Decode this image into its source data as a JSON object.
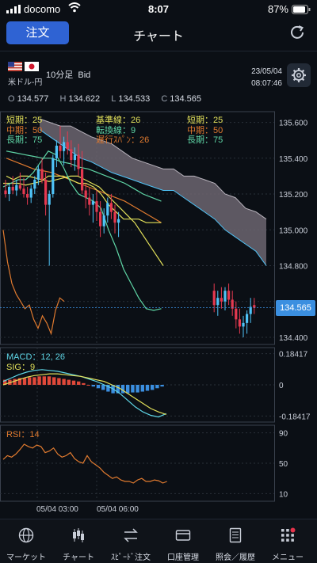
{
  "status_bar": {
    "carrier": "docomo",
    "time": "8:07",
    "battery": "87%"
  },
  "header": {
    "order_label": "注文",
    "title": "チャート"
  },
  "info": {
    "pair": "米ドル-円",
    "timeframe": "10分足",
    "side": "Bid",
    "date": "23/05/04",
    "time": "08:07:46"
  },
  "ohlc": [
    {
      "key": "O",
      "value": "134.577"
    },
    {
      "key": "H",
      "value": "134.622"
    },
    {
      "key": "L",
      "value": "134.533"
    },
    {
      "key": "C",
      "value": "134.565"
    }
  ],
  "main_legend": {
    "col1": [
      {
        "text": "短期：25",
        "color": "#e2e05a"
      },
      {
        "text": "中期：50",
        "color": "#e07a2f"
      },
      {
        "text": "長期：75",
        "color": "#5fd6a6"
      }
    ],
    "col2": [
      {
        "text": "基準線：26",
        "color": "#e2e05a"
      },
      {
        "text": "転換線：9",
        "color": "#5fd6a6"
      },
      {
        "text": "遅行ｽﾊﾟﾝ：26",
        "color": "#e07a2f"
      }
    ],
    "col3": [
      {
        "text": "短期：25",
        "color": "#e2e05a"
      },
      {
        "text": "中期：50",
        "color": "#e07a2f"
      },
      {
        "text": "長期：75",
        "color": "#5fd6a6"
      }
    ]
  },
  "current_price": "134.565",
  "macd": {
    "label": "MACD：12, 26",
    "sig": "SIG：9"
  },
  "rsi": {
    "label": "RSI：14"
  },
  "colors": {
    "up": "#4fc3f7",
    "down": "#e53950",
    "accent": "#2f63d3"
  },
  "chart_data": [
    {
      "type": "candlestick",
      "title": "",
      "ylim": [
        134.36,
        135.66
      ],
      "yticks": [
        135.6,
        135.4,
        135.2,
        135.0,
        134.8,
        134.6,
        134.4
      ],
      "ytick_labels": [
        "135.600",
        "135.400",
        "135.200",
        "135.000",
        "134.800",
        "134.565",
        "134.400"
      ],
      "x_labels": [
        "05/04 03:00",
        "05/04 06:00"
      ],
      "candles": [
        {
          "o": 135.22,
          "h": 135.28,
          "l": 135.18,
          "c": 135.2
        },
        {
          "o": 135.2,
          "h": 135.26,
          "l": 135.16,
          "c": 135.24
        },
        {
          "o": 135.24,
          "h": 135.3,
          "l": 135.2,
          "c": 135.22
        },
        {
          "o": 135.22,
          "h": 135.28,
          "l": 135.19,
          "c": 135.25
        },
        {
          "o": 135.25,
          "h": 135.32,
          "l": 135.22,
          "c": 135.23
        },
        {
          "o": 135.23,
          "h": 135.29,
          "l": 135.18,
          "c": 135.2
        },
        {
          "o": 135.2,
          "h": 135.24,
          "l": 135.14,
          "c": 135.18
        },
        {
          "o": 135.18,
          "h": 135.25,
          "l": 135.15,
          "c": 135.23
        },
        {
          "o": 135.23,
          "h": 135.3,
          "l": 135.2,
          "c": 135.28
        },
        {
          "o": 135.28,
          "h": 135.36,
          "l": 135.25,
          "c": 135.34
        },
        {
          "o": 135.34,
          "h": 135.4,
          "l": 135.26,
          "c": 135.28
        },
        {
          "o": 135.28,
          "h": 135.32,
          "l": 135.08,
          "c": 135.14
        },
        {
          "o": 135.14,
          "h": 135.22,
          "l": 134.8,
          "c": 135.2
        },
        {
          "o": 135.2,
          "h": 135.42,
          "l": 135.18,
          "c": 135.4
        },
        {
          "o": 135.4,
          "h": 135.5,
          "l": 135.35,
          "c": 135.47
        },
        {
          "o": 135.47,
          "h": 135.58,
          "l": 135.4,
          "c": 135.44
        },
        {
          "o": 135.44,
          "h": 135.52,
          "l": 135.36,
          "c": 135.49
        },
        {
          "o": 135.49,
          "h": 135.55,
          "l": 135.42,
          "c": 135.45
        },
        {
          "o": 135.45,
          "h": 135.5,
          "l": 135.35,
          "c": 135.39
        },
        {
          "o": 135.39,
          "h": 135.46,
          "l": 135.33,
          "c": 135.42
        },
        {
          "o": 135.42,
          "h": 135.48,
          "l": 135.3,
          "c": 135.34
        },
        {
          "o": 135.34,
          "h": 135.44,
          "l": 135.2,
          "c": 135.22
        },
        {
          "o": 135.22,
          "h": 135.26,
          "l": 135.12,
          "c": 135.18
        },
        {
          "o": 135.18,
          "h": 135.24,
          "l": 135.08,
          "c": 135.14
        },
        {
          "o": 135.14,
          "h": 135.2,
          "l": 135.04,
          "c": 135.16
        },
        {
          "o": 135.16,
          "h": 135.22,
          "l": 135.05,
          "c": 135.1
        },
        {
          "o": 135.1,
          "h": 135.16,
          "l": 134.96,
          "c": 135.02
        },
        {
          "o": 135.02,
          "h": 135.12,
          "l": 134.98,
          "c": 135.08
        },
        {
          "o": 135.08,
          "h": 135.18,
          "l": 135.04,
          "c": 135.15
        },
        {
          "o": 135.15,
          "h": 135.2,
          "l": 135.06,
          "c": 135.1
        },
        {
          "o": 135.1,
          "h": 135.14,
          "l": 134.98,
          "c": 135.04
        },
        {
          "o": 135.04,
          "h": 135.1,
          "l": 134.96,
          "c": 135.06
        },
        {
          "o": 134.66,
          "h": 134.7,
          "l": 134.54,
          "c": 134.58
        },
        {
          "o": 134.58,
          "h": 134.66,
          "l": 134.52,
          "c": 134.62
        },
        {
          "o": 134.62,
          "h": 134.68,
          "l": 134.56,
          "c": 134.6
        },
        {
          "o": 134.6,
          "h": 134.68,
          "l": 134.55,
          "c": 134.66
        },
        {
          "o": 134.66,
          "h": 134.7,
          "l": 134.58,
          "c": 134.61
        },
        {
          "o": 134.61,
          "h": 134.66,
          "l": 134.52,
          "c": 134.56
        },
        {
          "o": 134.56,
          "h": 134.6,
          "l": 134.45,
          "c": 134.5
        },
        {
          "o": 134.5,
          "h": 134.56,
          "l": 134.42,
          "c": 134.46
        },
        {
          "o": 134.46,
          "h": 134.52,
          "l": 134.4,
          "c": 134.48
        },
        {
          "o": 134.48,
          "h": 134.55,
          "l": 134.42,
          "c": 134.53
        },
        {
          "o": 134.53,
          "h": 134.62,
          "l": 134.48,
          "c": 134.57
        },
        {
          "o": 134.58,
          "h": 134.62,
          "l": 134.53,
          "c": 134.565
        }
      ],
      "ichimoku_upper": [
        135.62,
        135.6,
        135.58,
        135.58,
        135.55,
        135.52,
        135.5,
        135.48,
        135.44,
        135.4,
        135.38,
        135.36,
        135.34,
        135.34,
        135.3,
        135.3,
        135.28,
        135.26,
        135.2,
        135.18,
        135.12,
        135.1,
        135.06
      ],
      "ichimoku_lower": [
        135.56,
        135.52,
        135.48,
        135.44,
        135.4,
        135.38,
        135.35,
        135.32,
        135.3,
        135.28,
        135.26,
        135.24,
        135.22,
        135.22,
        135.18,
        135.14,
        135.1,
        135.06,
        135.0,
        134.96,
        134.92,
        134.88,
        134.8
      ],
      "ma_short": [
        135.3,
        135.28,
        135.3,
        135.3,
        135.29,
        135.28,
        135.27,
        135.28,
        135.29,
        135.3,
        135.3,
        135.28,
        135.26,
        135.24,
        135.2,
        135.16,
        135.12,
        135.08,
        135.04,
        134.98,
        134.92,
        134.86,
        134.8
      ],
      "ma_mid": [
        135.4,
        135.38,
        135.36,
        135.34,
        135.33,
        135.32,
        135.3,
        135.28,
        135.26,
        135.24,
        135.22,
        135.2,
        135.18,
        135.16,
        135.13,
        135.1,
        135.07,
        135.04
      ],
      "ma_long": [
        135.44,
        135.43,
        135.42,
        135.41,
        135.4,
        135.4,
        135.38,
        135.37,
        135.35,
        135.34,
        135.32,
        135.3,
        135.28,
        135.26,
        135.23,
        135.2,
        135.18,
        135.16
      ],
      "kijun": [
        135.26,
        135.26,
        135.26,
        135.25,
        135.26,
        135.27,
        135.3,
        135.3,
        135.3,
        135.28,
        135.26,
        135.26,
        135.24,
        135.2,
        135.14,
        135.1,
        135.06,
        135.06,
        135.06,
        135.04,
        135.04,
        135.04
      ],
      "tenkan": [
        135.24,
        135.26,
        135.28,
        135.28,
        135.32,
        135.38,
        135.44,
        135.42,
        135.35,
        135.26,
        135.2,
        135.18,
        135.16,
        135.12,
        135.0,
        134.9,
        134.78,
        134.7,
        134.62,
        134.56,
        134.55,
        134.56
      ],
      "chikou": [
        135.0,
        134.82,
        134.7,
        134.64,
        134.6,
        134.56,
        134.58,
        134.5,
        134.45,
        134.52,
        134.48,
        134.42,
        134.55,
        134.62,
        134.6
      ]
    },
    {
      "type": "bar",
      "title": "MACD",
      "ylim": [
        -0.22,
        0.22
      ],
      "ytick_labels": [
        "0.18417",
        "0",
        "-0.18417"
      ],
      "histogram": [
        0.03,
        0.03,
        0.035,
        0.04,
        0.04,
        0.045,
        0.045,
        0.05,
        0.05,
        0.05,
        0.045,
        0.04,
        0.035,
        0.03,
        0.025,
        0.02,
        0.01,
        0,
        -0.01,
        -0.02,
        -0.03,
        -0.04,
        -0.05,
        -0.05,
        -0.05,
        -0.05,
        -0.045,
        -0.045,
        -0.04,
        -0.035,
        -0.03,
        -0.02,
        -0.01
      ],
      "macd_line": [
        0.02,
        0.04,
        0.06,
        0.075,
        0.085,
        0.09,
        0.085,
        0.08,
        0.07,
        0.06,
        0.05,
        0.035,
        0.02,
        0.0,
        -0.02,
        -0.05,
        -0.09,
        -0.13,
        -0.16,
        -0.18,
        -0.19,
        -0.17
      ],
      "signal_line": [
        0.0,
        0.015,
        0.03,
        0.045,
        0.055,
        0.06,
        0.065,
        0.065,
        0.06,
        0.055,
        0.05,
        0.04,
        0.03,
        0.02,
        0.0,
        -0.02,
        -0.05,
        -0.08,
        -0.11,
        -0.14,
        -0.16,
        -0.175
      ]
    },
    {
      "type": "line",
      "title": "RSI",
      "ylim": [
        0,
        100
      ],
      "ytick_labels": [
        "90",
        "50",
        "10"
      ],
      "values": [
        55,
        60,
        58,
        62,
        68,
        75,
        72,
        70,
        74,
        72,
        64,
        66,
        70,
        62,
        58,
        60,
        64,
        56,
        52,
        50,
        60,
        52,
        48,
        44,
        38,
        34,
        30,
        32,
        28,
        26,
        26,
        24,
        28,
        30,
        26,
        26,
        28,
        27,
        24,
        26
      ]
    }
  ],
  "tabs": [
    {
      "label": "マーケット",
      "icon": "globe-icon"
    },
    {
      "label": "チャート",
      "icon": "candlestick-icon"
    },
    {
      "label": "ｽﾋﾟｰﾄﾞ注文",
      "icon": "swap-icon"
    },
    {
      "label": "口座管理",
      "icon": "card-icon"
    },
    {
      "label": "照会／履歴",
      "icon": "document-icon"
    },
    {
      "label": "メニュー",
      "icon": "grid-icon"
    }
  ]
}
